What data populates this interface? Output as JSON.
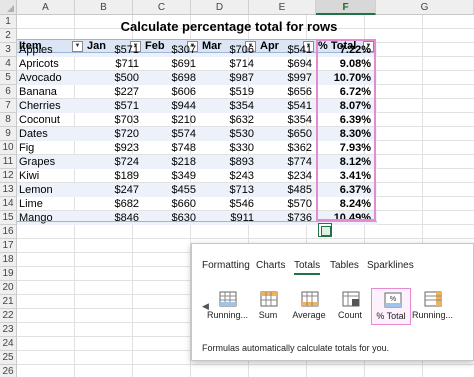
{
  "columns": [
    "A",
    "B",
    "C",
    "D",
    "E",
    "F",
    "G"
  ],
  "selected_column": "F",
  "rows": [
    "1",
    "2",
    "3",
    "4",
    "5",
    "6",
    "7",
    "8",
    "9",
    "10",
    "11",
    "12",
    "13",
    "14",
    "15",
    "16",
    "17",
    "18",
    "19",
    "20",
    "21",
    "22",
    "23",
    "24",
    "25",
    "26"
  ],
  "title": "Calculate percentage total for rows",
  "table": {
    "headers": [
      "Item",
      "Jan",
      "Feb",
      "Mar",
      "Apr",
      "% Total"
    ],
    "rows": [
      [
        "Apples",
        "$571",
        "$307",
        "$706",
        "$541",
        "7.22%"
      ],
      [
        "Apricots",
        "$711",
        "$691",
        "$714",
        "$694",
        "9.08%"
      ],
      [
        "Avocado",
        "$500",
        "$698",
        "$987",
        "$997",
        "10.70%"
      ],
      [
        "Banana",
        "$227",
        "$606",
        "$519",
        "$656",
        "6.72%"
      ],
      [
        "Cherries",
        "$571",
        "$944",
        "$354",
        "$541",
        "8.07%"
      ],
      [
        "Coconut",
        "$703",
        "$210",
        "$632",
        "$354",
        "6.39%"
      ],
      [
        "Dates",
        "$720",
        "$574",
        "$530",
        "$650",
        "8.30%"
      ],
      [
        "Fig",
        "$923",
        "$748",
        "$330",
        "$362",
        "7.93%"
      ],
      [
        "Grapes",
        "$724",
        "$218",
        "$893",
        "$774",
        "8.12%"
      ],
      [
        "Kiwi",
        "$189",
        "$349",
        "$243",
        "$234",
        "3.41%"
      ],
      [
        "Lemon",
        "$247",
        "$455",
        "$713",
        "$485",
        "6.37%"
      ],
      [
        "Lime",
        "$682",
        "$660",
        "$546",
        "$570",
        "8.24%"
      ],
      [
        "Mango",
        "$846",
        "$630",
        "$911",
        "$736",
        "10.49%"
      ]
    ]
  },
  "quick_analysis": {
    "tabs": [
      {
        "label": "Formatting",
        "key": "F"
      },
      {
        "label": "Charts",
        "key": "C"
      },
      {
        "label": "Totals",
        "key": "O"
      },
      {
        "label": "Tables",
        "key": "T"
      },
      {
        "label": "Sparklines",
        "key": "S"
      }
    ],
    "active_tab": "Totals",
    "options": [
      "Running...",
      "Sum",
      "Average",
      "Count",
      "% Total",
      "Running..."
    ],
    "selected_option": "% Total",
    "hint": "Formulas automatically calculate totals for you."
  },
  "colors": {
    "header_fill": "#dbe5f4",
    "band_fill": "#edf2fa",
    "selection": "#e58ad3",
    "excel_green": "#217346"
  }
}
